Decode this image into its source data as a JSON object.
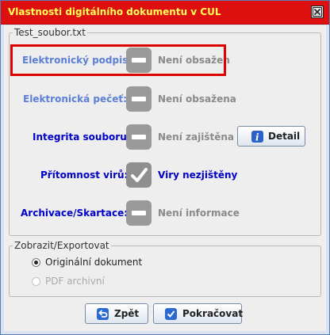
{
  "window": {
    "title": "Vlastnosti digitálního dokumentu v CUL"
  },
  "file_group": {
    "legend": "Test_soubor.txt",
    "rows": [
      {
        "label": "Elektronický podpis:",
        "status": "Není obsažen",
        "icon": "dash-icon"
      },
      {
        "label": "Elektronická pečeť:",
        "status": "Není obsažena",
        "icon": "dash-icon"
      },
      {
        "label": "Integrita souboru:",
        "status": "Není zajištěna",
        "icon": "dash-icon"
      },
      {
        "label": "Přítomnost virů:",
        "status": "Viry nezjištěny",
        "icon": "check-icon"
      },
      {
        "label": "Archivace/Skartace:",
        "status": "Není informace",
        "icon": "dash-icon"
      }
    ],
    "detail_button": "Detail"
  },
  "export_group": {
    "legend": "Zobrazit/Exportovat",
    "options": [
      {
        "label": "Originální dokument",
        "selected": true,
        "enabled": true
      },
      {
        "label": "PDF archivní",
        "selected": false,
        "enabled": false
      }
    ]
  },
  "buttons": {
    "back": "Zpět",
    "continue": "Pokračovat"
  },
  "colors": {
    "title_bar": "#de0f0f",
    "title_text": "#ffff55",
    "label_blue": "#0000c8",
    "highlight_red": "#e00000"
  }
}
